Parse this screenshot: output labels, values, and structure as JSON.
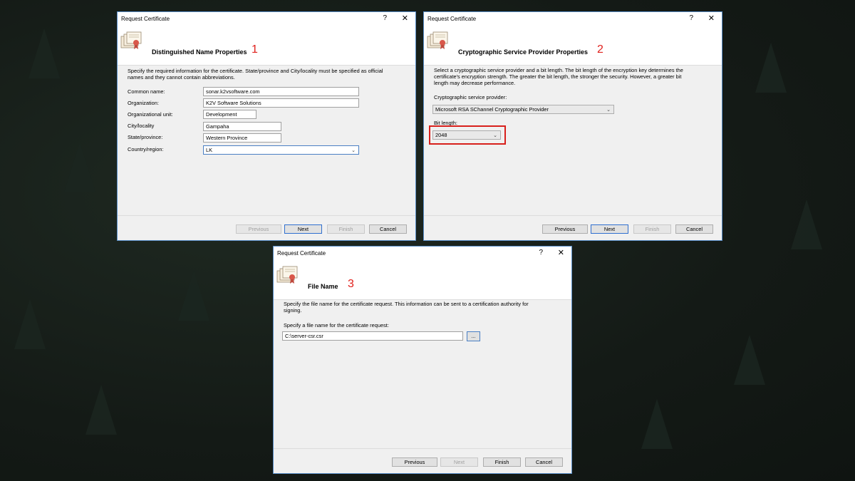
{
  "dialogs": [
    {
      "title": "Request Certificate",
      "help": "?",
      "close": "✕",
      "heading": "Distinguished Name Properties",
      "step": "1",
      "description": "Specify the required information for the certificate. State/province and City/locality must be specified as official names and they cannot contain abbreviations.",
      "fields": {
        "common_name": {
          "label": "Common name:",
          "value": "sonar.k2vsoftware.com"
        },
        "organization": {
          "label": "Organization:",
          "value": "K2V Software Solutions"
        },
        "org_unit": {
          "label": "Organizational unit:",
          "value": "Development"
        },
        "city": {
          "label": "City/locality",
          "value": "Gampaha"
        },
        "state": {
          "label": "State/province:",
          "value": "Western Province"
        },
        "country": {
          "label": "Country/region:",
          "value": "LK"
        }
      },
      "buttons": {
        "previous": "Previous",
        "next": "Next",
        "finish": "Finish",
        "cancel": "Cancel"
      }
    },
    {
      "title": "Request Certificate",
      "help": "?",
      "close": "✕",
      "heading": "Cryptographic Service Provider Properties",
      "step": "2",
      "description": "Select a cryptographic service provider and a bit length. The bit length of the encryption key determines the certificate's encryption strength. The greater the bit length, the stronger the security. However, a greater bit length may decrease performance.",
      "csp_label": "Cryptographic service provider:",
      "csp_value": "Microsoft RSA SChannel Cryptographic Provider",
      "bit_label": "Bit length:",
      "bit_value": "2048",
      "buttons": {
        "previous": "Previous",
        "next": "Next",
        "finish": "Finish",
        "cancel": "Cancel"
      }
    },
    {
      "title": "Request Certificate",
      "help": "?",
      "close": "✕",
      "heading": "File Name",
      "step": "3",
      "description": "Specify the file name for the certificate request. This information can be sent to a certification authority for signing.",
      "file_label": "Specify a file name for the certificate request:",
      "file_value": "C:\\server-csr.csr",
      "browse": "...",
      "buttons": {
        "previous": "Previous",
        "next": "Next",
        "finish": "Finish",
        "cancel": "Cancel"
      }
    }
  ],
  "colors": {
    "accent": "#5a8fc9",
    "highlight": "#d8201c",
    "step_number": "#e0201c"
  }
}
